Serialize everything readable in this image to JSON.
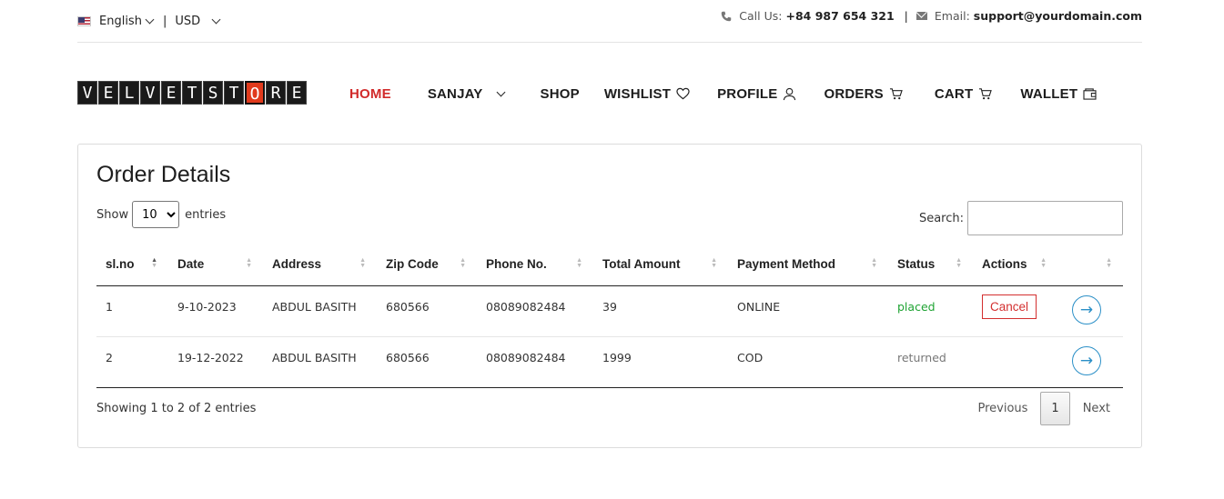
{
  "topbar": {
    "language": "English",
    "currency": "USD",
    "call_label": "Call Us:",
    "phone": "+84 987 654 321",
    "divider": "|",
    "email_label": "Email:",
    "email": "support@yourdomain.com"
  },
  "logo": {
    "letters": [
      "V",
      "E",
      "L",
      "V",
      "E",
      "T",
      "S",
      "T",
      "O",
      "R",
      "E"
    ]
  },
  "nav": {
    "home": "HOME",
    "user": "SANJAY",
    "shop": "SHOP",
    "wishlist": "WISHLIST",
    "profile": "PROFILE",
    "orders": "ORDERS",
    "cart": "CART",
    "wallet": "WALLET"
  },
  "card": {
    "title": "Order Details",
    "show_label": "Show",
    "entries_label": "entries",
    "page_length": "10",
    "search_label": "Search:",
    "search_value": ""
  },
  "table": {
    "headers": [
      "sl.no",
      "Date",
      "Address",
      "Zip Code",
      "Phone No.",
      "Total Amount",
      "Payment Method",
      "Status",
      "Actions",
      ""
    ],
    "rows": [
      {
        "slno": "1",
        "date": "9-10-2023",
        "address": "ABDUL BASITH",
        "zip": "680566",
        "phone": "08089082484",
        "total": "39",
        "payment": "ONLINE",
        "status": "placed",
        "action": "Cancel"
      },
      {
        "slno": "2",
        "date": "19-12-2022",
        "address": "ABDUL BASITH",
        "zip": "680566",
        "phone": "08089082484",
        "total": "1999",
        "payment": "COD",
        "status": "returned",
        "action": ""
      }
    ]
  },
  "footer": {
    "info": "Showing 1 to 2 of 2 entries",
    "previous": "Previous",
    "current_page": "1",
    "next": "Next"
  },
  "icons": {
    "arrow": "→",
    "flag": "us-flag-icon"
  },
  "colors": {
    "accent_red": "#d12a2a",
    "status_placed": "#1fa333",
    "arrow_blue": "#2a8fc7"
  }
}
